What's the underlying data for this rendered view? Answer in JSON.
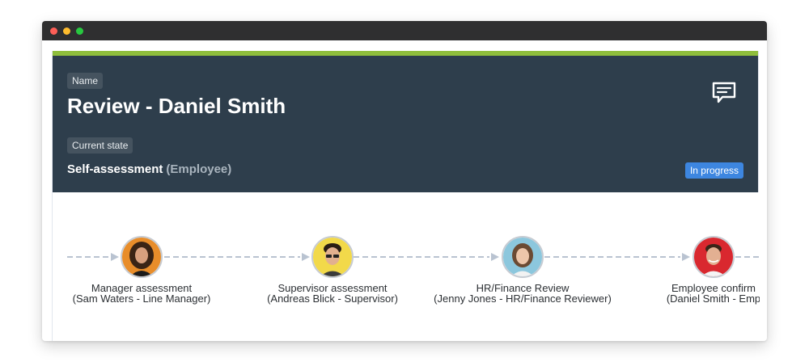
{
  "header": {
    "name_label": "Name",
    "title": "Review - Daniel Smith",
    "current_state_label": "Current state",
    "state_name": "Self-assessment",
    "state_role": "(Employee)",
    "status_badge": "In progress",
    "comment_icon": "comment-icon"
  },
  "colors": {
    "accent": "#8fbe3c",
    "header_bg": "#2e3e4c",
    "badge": "#3d86e0"
  },
  "workflow": {
    "steps": [
      {
        "title": "Manager assessment",
        "subtitle": "(Sam Waters - Line Manager)",
        "avatar_bg": "#e88d2a"
      },
      {
        "title": "Supervisor assessment",
        "subtitle": "(Andreas Blick - Supervisor)",
        "avatar_bg": "#f2d94a"
      },
      {
        "title": "HR/Finance Review",
        "subtitle": "(Jenny Jones - HR/Finance Reviewer)",
        "avatar_bg": "#8cc7dd"
      },
      {
        "title": "Employee confirm",
        "subtitle": "(Daniel Smith - Emp",
        "avatar_bg": "#d9282f"
      }
    ]
  }
}
